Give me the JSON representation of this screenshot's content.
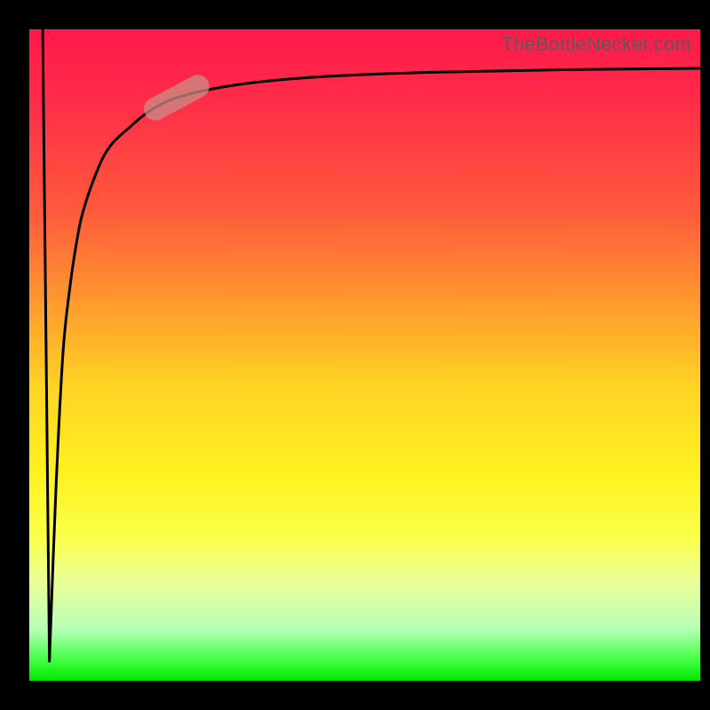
{
  "attribution": "TheBottleNecker.com",
  "chart_data": {
    "type": "line",
    "title": "",
    "xlabel": "",
    "ylabel": "",
    "xlim": [
      0,
      100
    ],
    "ylim": [
      0,
      100
    ],
    "x": [
      3,
      4,
      5,
      6,
      7,
      8,
      10,
      12,
      15,
      18,
      22,
      28,
      35,
      45,
      60,
      80,
      100
    ],
    "values": [
      3,
      30,
      50,
      60,
      67,
      72,
      78,
      82,
      85,
      87.5,
      89.5,
      91,
      92,
      92.8,
      93.4,
      93.8,
      94
    ],
    "background_gradient": {
      "stops": [
        {
          "pct": 0,
          "color": "#ff1a4a"
        },
        {
          "pct": 50,
          "color": "#ffd424"
        },
        {
          "pct": 100,
          "color": "#00e600"
        }
      ]
    },
    "highlight_segment": {
      "x0": 18,
      "x1": 26,
      "rotation_deg": -28
    }
  }
}
